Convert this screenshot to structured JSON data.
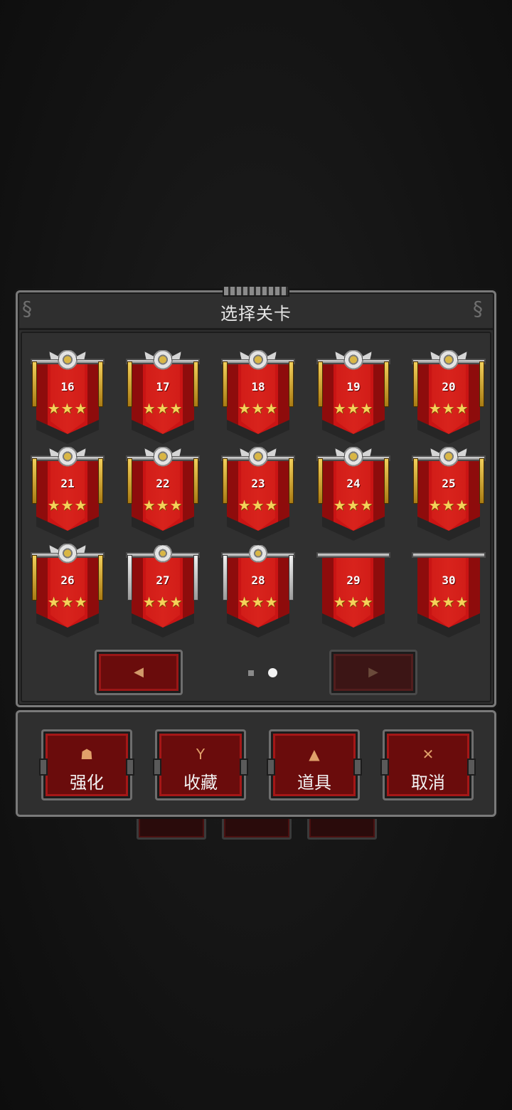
{
  "dialog": {
    "title": "选择关卡"
  },
  "levels": [
    {
      "number": "16",
      "stars": "★★★"
    },
    {
      "number": "17",
      "stars": "★★★"
    },
    {
      "number": "18",
      "stars": "★★★"
    },
    {
      "number": "19",
      "stars": "★★★"
    },
    {
      "number": "20",
      "stars": "★★★"
    },
    {
      "number": "21",
      "stars": "★★★"
    },
    {
      "number": "22",
      "stars": "★★★"
    },
    {
      "number": "23",
      "stars": "★★★"
    },
    {
      "number": "24",
      "stars": "★★★"
    },
    {
      "number": "25",
      "stars": "★★★"
    },
    {
      "number": "26",
      "stars": "★★★"
    },
    {
      "number": "27",
      "stars": "★★★"
    },
    {
      "number": "28",
      "stars": "★★★"
    },
    {
      "number": "29",
      "stars": "★★★"
    },
    {
      "number": "30",
      "stars": "★★★"
    }
  ],
  "pagination": {
    "prev_icon": "◀",
    "next_icon": "▶",
    "current_page": 2,
    "total_pages": 2
  },
  "actions": {
    "upgrade": {
      "icon": "☗",
      "label": "强化"
    },
    "collection": {
      "icon": "Y",
      "label": "收藏"
    },
    "items": {
      "icon": "▲",
      "label": "道具"
    },
    "cancel": {
      "icon": "✕",
      "label": "取消"
    }
  },
  "colors": {
    "background": "#141414",
    "panel": "#2f2f2f",
    "banner_red": "#c91414",
    "star_gold": "#f5d15a"
  }
}
